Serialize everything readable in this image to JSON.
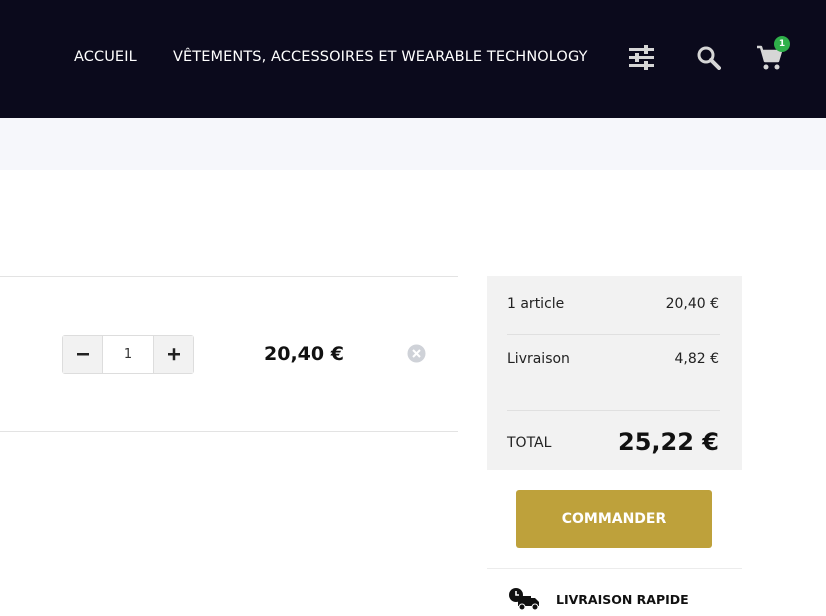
{
  "header": {
    "nav": [
      {
        "label": "ACCUEIL"
      },
      {
        "label": "VÊTEMENTS, ACCESSOIRES ET WEARABLE TECHNOLOGY"
      }
    ],
    "icons": {
      "filter": "sliders-icon",
      "search": "search-icon",
      "cart": "cart-icon"
    },
    "cart_count": "1"
  },
  "cart_item": {
    "quantity": "1",
    "price": "20,40 €"
  },
  "summary": {
    "items_label": "1 article",
    "items_value": "20,40 €",
    "shipping_label": "Livraison",
    "shipping_value": "4,82 €",
    "total_label": "TOTAL",
    "total_value": "25,22 €"
  },
  "order_button": "COMMANDER",
  "reassurance": {
    "delivery_label": "LIVRAISON RAPIDE"
  },
  "colors": {
    "header_bg": "#0b0a1c",
    "accent": "#bea13b",
    "badge": "#2fb04a"
  }
}
